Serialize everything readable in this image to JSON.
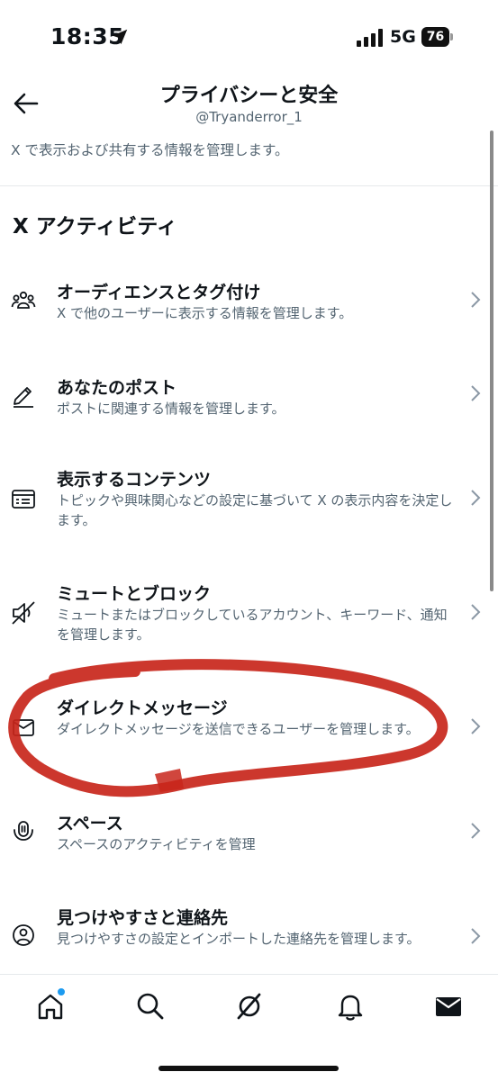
{
  "status_bar": {
    "time": "18:35",
    "network": "5G",
    "battery": "76"
  },
  "header": {
    "title": "プライバシーと安全",
    "subtitle": "@Tryanderror_1",
    "description": "X で表示および共有する情報を管理します。"
  },
  "section": {
    "heading": "X アクティビティ"
  },
  "items": [
    {
      "title": "オーディエンスとタグ付け",
      "desc": "X で他のユーザーに表示する情報を管理します。",
      "icon": "audience-icon"
    },
    {
      "title": "あなたのポスト",
      "desc": "ポストに関連する情報を管理します。",
      "icon": "pencil-icon"
    },
    {
      "title": "表示するコンテンツ",
      "desc": "トピックや興味関心などの設定に基づいて X の表示内容を決定します。",
      "icon": "content-icon"
    },
    {
      "title": "ミュートとブロック",
      "desc": "ミュートまたはブロックしているアカウント、キーワード、通知を管理します。",
      "icon": "mute-icon"
    },
    {
      "title": "ダイレクトメッセージ",
      "desc": "ダイレクトメッセージを送信できるユーザーを管理します。",
      "icon": "envelope-icon"
    },
    {
      "title": "スペース",
      "desc": "スペースのアクティビティを管理",
      "icon": "spaces-icon"
    },
    {
      "title": "見つけやすさと連絡先",
      "desc": "見つけやすさの設定とインポートした連絡先を管理します。",
      "icon": "contacts-icon"
    }
  ],
  "colors": {
    "annotation": "#c8261b",
    "accent": "#1d9bf0",
    "secondary_text": "#536471"
  },
  "bottom_nav": [
    "home-icon",
    "search-icon",
    "grok-icon",
    "bell-icon",
    "mail-icon"
  ]
}
